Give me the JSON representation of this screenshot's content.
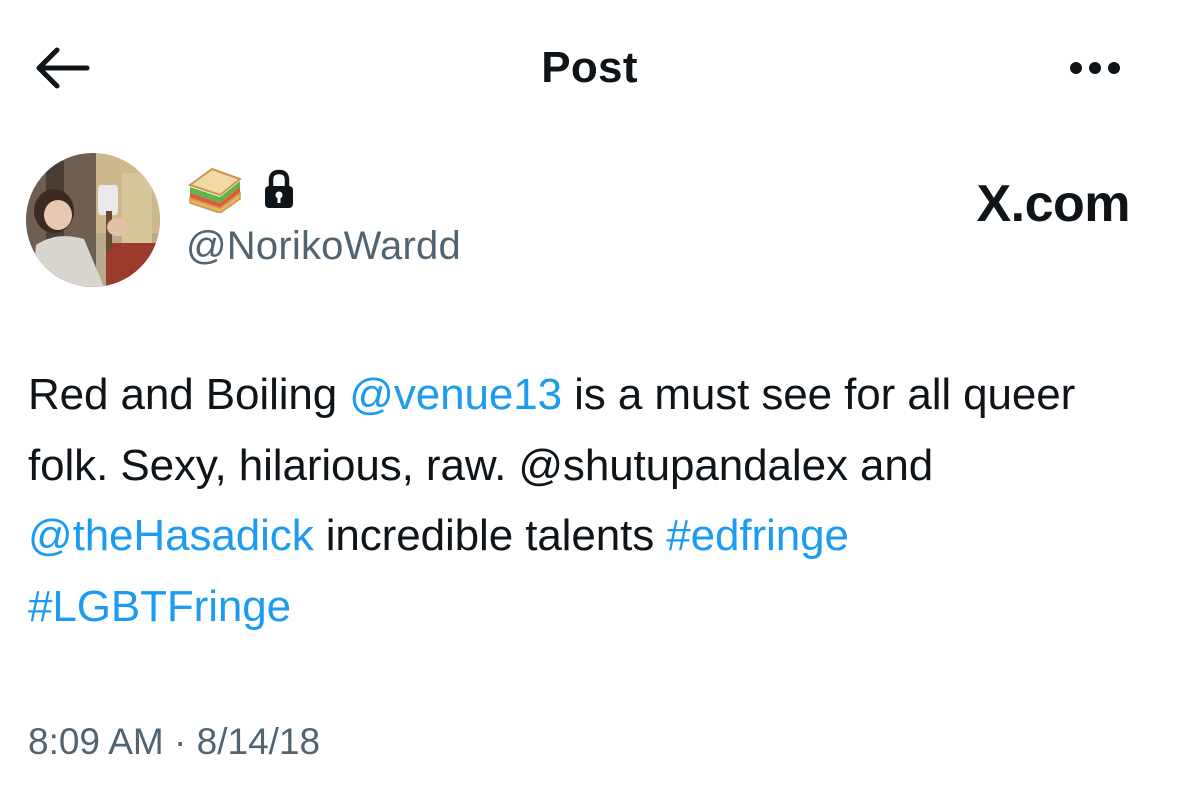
{
  "header": {
    "title": "Post",
    "back_icon": "arrow-left-icon",
    "more_icon": "more-horizontal-icon"
  },
  "author": {
    "display_name_icons": [
      "sandwich-emoji-icon",
      "lock-icon"
    ],
    "handle": "@NorikoWardd",
    "avatar": "avatar-photo"
  },
  "brand": {
    "label": "X.com"
  },
  "post": {
    "seg1": "Red and Boiling ",
    "mention1": "@venue13",
    "seg2": " is a must see for all queer folk. Sexy, hilarious, raw. @shutupandalex and ",
    "mention2": "@theHasadick",
    "seg3": " incredible talents ",
    "hashtag1": "#edfringe",
    "seg4": " ",
    "hashtag2": "#LGBTFringe"
  },
  "meta": {
    "timestamp": "8:09 AM · 8/14/18"
  },
  "colors": {
    "link": "#1d9bf0",
    "text": "#0f1419",
    "secondary": "#536471",
    "background": "#ffffff"
  }
}
